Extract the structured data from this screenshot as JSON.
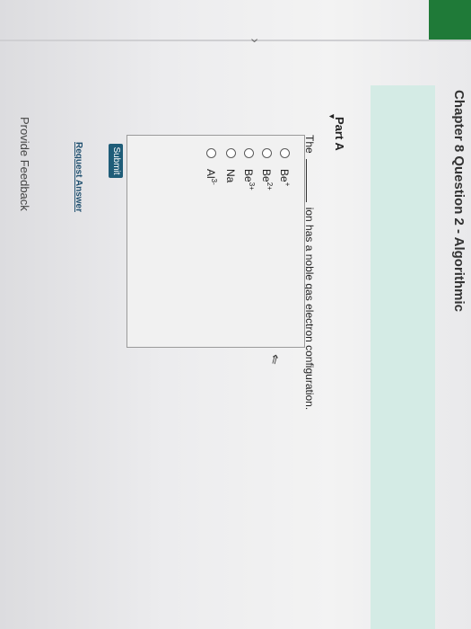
{
  "header": {
    "chapter_title": "Chapter 8 Question 2 - Algorithmic"
  },
  "part": {
    "label": "Part A",
    "collapse_icon": "triangle-down-icon"
  },
  "question": {
    "prefix": "The",
    "suffix": "ion has a noble gas electron configuration."
  },
  "options": [
    {
      "base": "Be",
      "charge": "+"
    },
    {
      "base": "Be",
      "charge": "2+"
    },
    {
      "base": "Be",
      "charge": "3+"
    },
    {
      "base": "Na",
      "charge": ""
    },
    {
      "base": "Al",
      "charge": "3-"
    }
  ],
  "actions": {
    "submit_label": "Submit",
    "request_label": "Request Answer"
  },
  "footer": {
    "feedback_label": "Provide Feedback"
  },
  "colors": {
    "accent_green": "#1f7a38",
    "teal_band": "#d4ebe5",
    "submit_bg": "#1f5d78"
  }
}
